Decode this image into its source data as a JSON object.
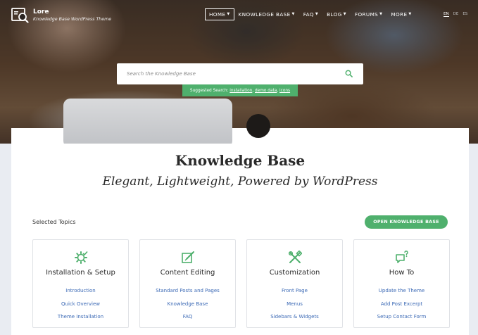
{
  "header": {
    "site_name": "Lore",
    "tagline": "Knowledge Base WordPress Theme",
    "nav": [
      {
        "label": "HOME",
        "active": true,
        "has_dropdown": true
      },
      {
        "label": "KNOWLEDGE BASE",
        "active": false,
        "has_dropdown": true
      },
      {
        "label": "FAQ",
        "active": false,
        "has_dropdown": true
      },
      {
        "label": "BLOG",
        "active": false,
        "has_dropdown": true
      },
      {
        "label": "FORUMS",
        "active": false,
        "has_dropdown": true
      },
      {
        "label": "MORE",
        "active": false,
        "has_dropdown": true
      }
    ],
    "languages": [
      "EN",
      "DE",
      "ES"
    ],
    "active_language": "EN"
  },
  "search": {
    "placeholder": "Search the Knowledge Base",
    "suggested_label": "Suggested Search:",
    "suggestions": [
      "installation",
      "demo data",
      "icons"
    ]
  },
  "main": {
    "title": "Knowledge Base",
    "subtitle": "Elegant, Lightweight, Powered by WordPress",
    "selected_topics_label": "Selected Topics",
    "open_kb_label": "OPEN KNOWLEDGE BASE",
    "topics": [
      {
        "title": "Installation & Setup",
        "icon": "gear-check-icon",
        "links": [
          "Introduction",
          "Quick Overview",
          "Theme Installation"
        ]
      },
      {
        "title": "Content Editing",
        "icon": "edit-icon",
        "links": [
          "Standard Posts and Pages",
          "Knowledge Base",
          "FAQ"
        ]
      },
      {
        "title": "Customization",
        "icon": "tools-icon",
        "links": [
          "Front Page",
          "Menus",
          "Sidebars & Widgets"
        ]
      },
      {
        "title": "How To",
        "icon": "question-bubble-icon",
        "links": [
          "Update the Theme",
          "Add Post Excerpt",
          "Setup Contact Form"
        ]
      }
    ]
  },
  "colors": {
    "accent": "#4fb06d",
    "link": "#3b69b5",
    "text": "#2a2a2a"
  }
}
